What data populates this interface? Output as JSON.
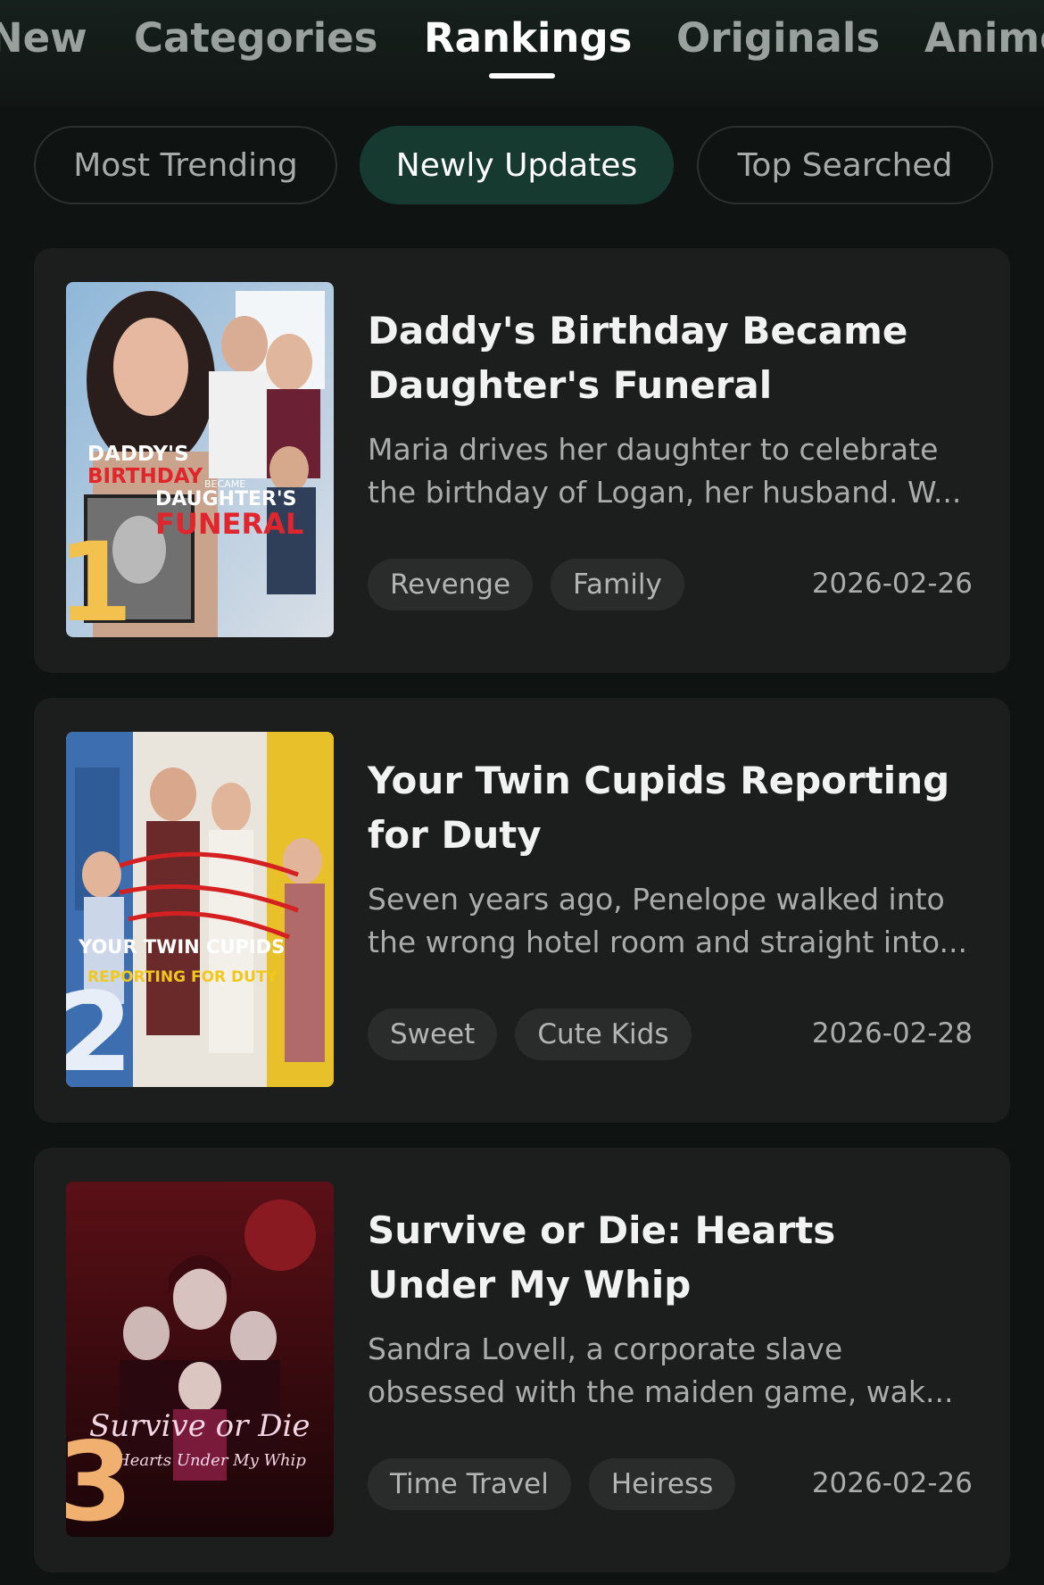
{
  "nav": {
    "tabs": [
      {
        "label": "New"
      },
      {
        "label": "Categories"
      },
      {
        "label": "Rankings"
      },
      {
        "label": "Originals"
      },
      {
        "label": "Anime"
      }
    ],
    "active_tab": "Rankings"
  },
  "filters": {
    "pills": [
      {
        "label": "Most Trending"
      },
      {
        "label": "Newly Updates"
      },
      {
        "label": "Top Searched"
      }
    ],
    "active": "Newly Updates"
  },
  "dramas": [
    {
      "rank": "1",
      "title": "Daddy's Birthday Became Daughter's Funeral",
      "description": "Maria drives her daughter to celebrate the birthday of Logan, her husband. W...",
      "tags": [
        "Revenge",
        "Family"
      ],
      "date": "2026-02-26",
      "cover_text": {
        "line1": "DADDY'S",
        "line2": "BIRTHDAY",
        "line2b": "BECAME",
        "line3": "DAUGHTER'S",
        "line4": "FUNERAL"
      },
      "rank_color": "#f2c14e"
    },
    {
      "rank": "2",
      "title": "Your Twin Cupids Reporting for Duty",
      "description": "Seven years ago, Penelope walked into the wrong hotel room and straight into...",
      "tags": [
        "Sweet",
        "Cute Kids"
      ],
      "date": "2026-02-28",
      "cover_text": {
        "line1": "YOUR TWIN CUPIDS",
        "line2": "REPORTING FOR DUTY"
      },
      "rank_color": "#e8eef8"
    },
    {
      "rank": "3",
      "title": "Survive or Die: Hearts Under My Whip",
      "description": "Sandra Lovell, a corporate slave obsessed with the maiden game, wak...",
      "tags": [
        "Time Travel",
        "Heiress"
      ],
      "date": "2026-02-26",
      "cover_text": {
        "line1": "Survive or Die",
        "line2": "Hearts Under My Whip"
      },
      "rank_color": "#f0b070"
    }
  ]
}
